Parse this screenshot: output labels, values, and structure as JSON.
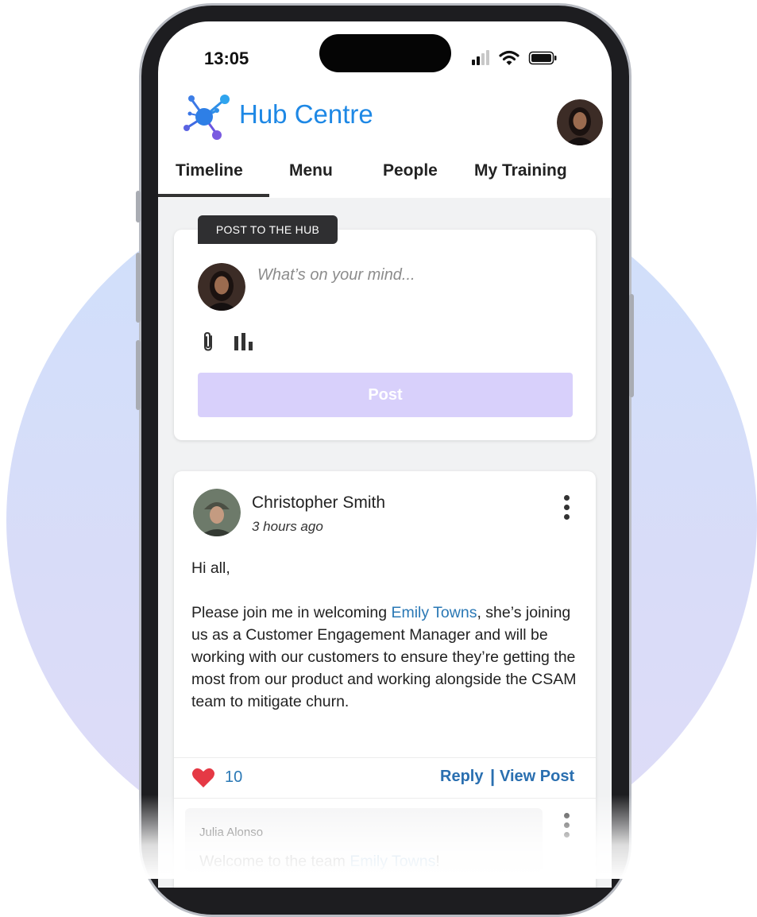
{
  "status_bar": {
    "time": "13:05"
  },
  "header": {
    "brand": "Hub Centre"
  },
  "tabs": [
    {
      "label": "Timeline"
    },
    {
      "label": "Menu"
    },
    {
      "label": "People"
    },
    {
      "label": "My Training"
    }
  ],
  "compose": {
    "badge": "POST TO THE HUB",
    "placeholder": "What’s on your mind...",
    "post_label": "Post"
  },
  "post": {
    "author": "Christopher Smith",
    "time": "3 hours ago",
    "greeting": "Hi all,",
    "body_before": "Please join me in welcoming ",
    "mention": "Emily Towns",
    "body_after": ", she’s joining us as a Customer Engagement Manager and will be working with our customers to ensure they’re getting the most from our product and working alongside the CSAM team to mitigate churn.",
    "likes": "10",
    "reply_label": "Reply",
    "separator": "|",
    "view_label": "View Post"
  },
  "comment": {
    "author": "Julia Alonso",
    "text_before": "Welcome to the team ",
    "mention": "Emily Towns",
    "text_after": "!"
  },
  "colors": {
    "brand_blue": "#1e88e5",
    "link_blue": "#2a78b5",
    "post_button": "#d8d0fb",
    "heart": "#e53945"
  }
}
